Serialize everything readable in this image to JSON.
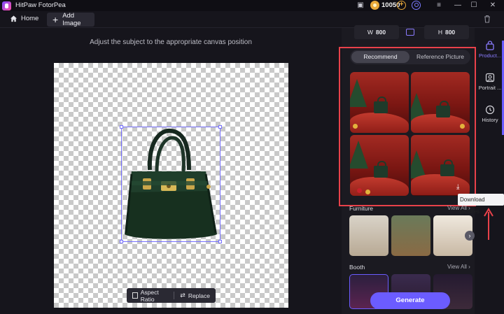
{
  "app": {
    "title": "HitPaw FotorPea",
    "credits": "10050"
  },
  "toolbar": {
    "home_label": "Home",
    "add_image_label": "Add Image"
  },
  "canvas": {
    "hint": "Adjust the subject to the appropriate canvas position"
  },
  "image_tools": {
    "aspect_ratio": "Aspect Ratio",
    "replace": "Replace"
  },
  "dimensions": {
    "w_label": "W",
    "w_value": "800",
    "h_label": "H",
    "h_value": "800"
  },
  "tabs": {
    "recommend": "Recommend",
    "reference": "Reference Picture"
  },
  "sections": [
    {
      "title": "Furniture",
      "view_all": "View All"
    },
    {
      "title": "Booth",
      "view_all": "View All"
    }
  ],
  "generate_label": "Generate",
  "side_tabs": [
    {
      "label": "Product...",
      "icon": "bag-icon"
    },
    {
      "label": "Portrait ...",
      "icon": "portrait-icon"
    },
    {
      "label": "History",
      "icon": "history-icon"
    }
  ],
  "tooltip": "Download pictures",
  "colors": {
    "accent": "#6b5cff",
    "highlight": "#e8414a",
    "coin": "#e9a93a"
  }
}
